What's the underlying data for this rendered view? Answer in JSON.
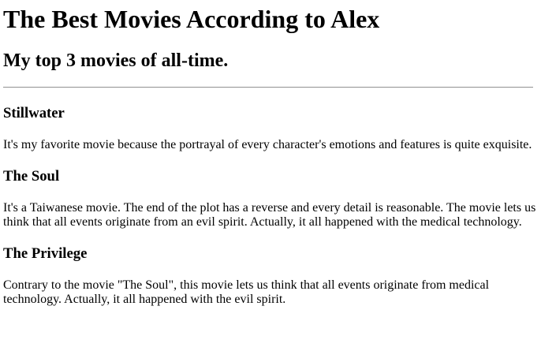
{
  "page": {
    "title": "The Best Movies According to Alex",
    "subtitle": "My top 3 movies of all-time."
  },
  "movies": [
    {
      "name": "Stillwater",
      "description": "It's my favorite movie because the portrayal of every character's emotions and features is quite exquisite."
    },
    {
      "name": "The Soul",
      "description": "It's a Taiwanese movie. The end of the plot has a reverse and every detail is reasonable. The movie lets us think that all events originate from an evil spirit. Actually, it all happened with the medical technology."
    },
    {
      "name": "The Privilege",
      "description": "Contrary to the movie \"The Soul\", this movie lets us think that all events originate from medical technology. Actually, it all happened with the evil spirit."
    }
  ]
}
